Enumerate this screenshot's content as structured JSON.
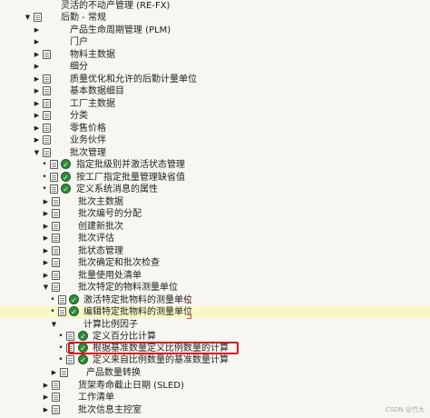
{
  "tree": {
    "items": [
      {
        "label": "灵活的不动产管理 (RE-FX)"
      },
      {
        "label": "后勤 - 常规"
      },
      {
        "label": "产品生命周期管理 (PLM)"
      },
      {
        "label": "门户"
      },
      {
        "label": "物料主数据"
      },
      {
        "label": "细分"
      },
      {
        "label": "质量优化和允许的后勤计量单位"
      },
      {
        "label": "基本数据细目"
      },
      {
        "label": "工厂主数据"
      },
      {
        "label": "分类"
      },
      {
        "label": "零售价格"
      },
      {
        "label": "业务伙伴"
      },
      {
        "label": "批次管理"
      },
      {
        "label": "指定批级别并激活状态管理"
      },
      {
        "label": "按工厂指定批量管理缺省值"
      },
      {
        "label": "定义系统消息的属性"
      },
      {
        "label": "批次主数据"
      },
      {
        "label": "批次编号的分配"
      },
      {
        "label": "创建新批次"
      },
      {
        "label": "批次评估"
      },
      {
        "label": "批状态管理"
      },
      {
        "label": "批次确定和批次检查"
      },
      {
        "label": "批量使用处清单"
      },
      {
        "label": "批次特定的物料测量单位"
      },
      {
        "label": "激活特定批物料的测量单位"
      },
      {
        "label": "编辑特定批物料的测量单位"
      },
      {
        "label": "计算比例因子"
      },
      {
        "label": "定义百分比计算"
      },
      {
        "label": "根据基准数量定义比例数量的计算"
      },
      {
        "label": "定义来自比例数量的基准数量计算"
      },
      {
        "label": "产品数量转换"
      },
      {
        "label": "货架寿命截止日期 (SLED)"
      },
      {
        "label": "工作清单"
      },
      {
        "label": "批次信息主控室"
      }
    ]
  },
  "watermark": "CSDN @竹大"
}
